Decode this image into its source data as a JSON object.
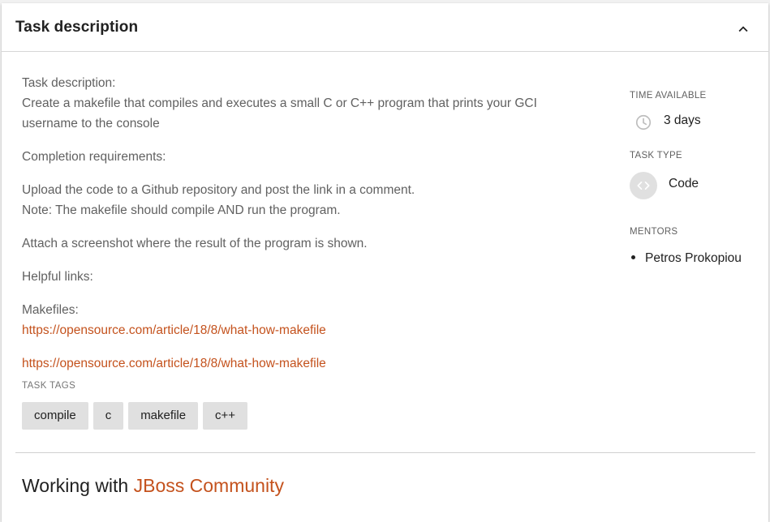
{
  "header": {
    "title": "Task description"
  },
  "description": {
    "heading": "Task description:",
    "body": "Create a makefile that compiles and executes a small C or C++ program that prints your GCI username to the console",
    "completion_heading": "Completion requirements:",
    "requirement_line1": "Upload the code to a Github repository and post the link in a comment.",
    "requirement_line2": "Note: The makefile should compile AND run the program.",
    "screenshot_line": "Attach a screenshot where the result of the program is shown.",
    "helpful_links": "Helpful links:",
    "makefiles_label": "Makefiles:",
    "link1": "https://opensource.com/article/18/8/what-how-makefile",
    "link2": "https://opensource.com/article/18/8/what-how-makefile"
  },
  "tags": {
    "label": "TASK TAGS",
    "items": [
      "compile",
      "c",
      "makefile",
      "c++"
    ]
  },
  "sidebar": {
    "time_label": "TIME AVAILABLE",
    "time_value": "3 days",
    "type_label": "TASK TYPE",
    "type_value": "Code",
    "mentors_label": "MENTORS",
    "mentors": [
      "Petros Prokopiou"
    ]
  },
  "footer": {
    "working_prefix": "Working with",
    "organization": "JBoss Community"
  },
  "colors": {
    "accent": "#c4521d",
    "chip_bg": "#e0e0e0",
    "muted_text": "#616161"
  },
  "icons": {
    "collapse": "chevron-up-icon",
    "time": "clock-icon",
    "type": "code-icon"
  }
}
